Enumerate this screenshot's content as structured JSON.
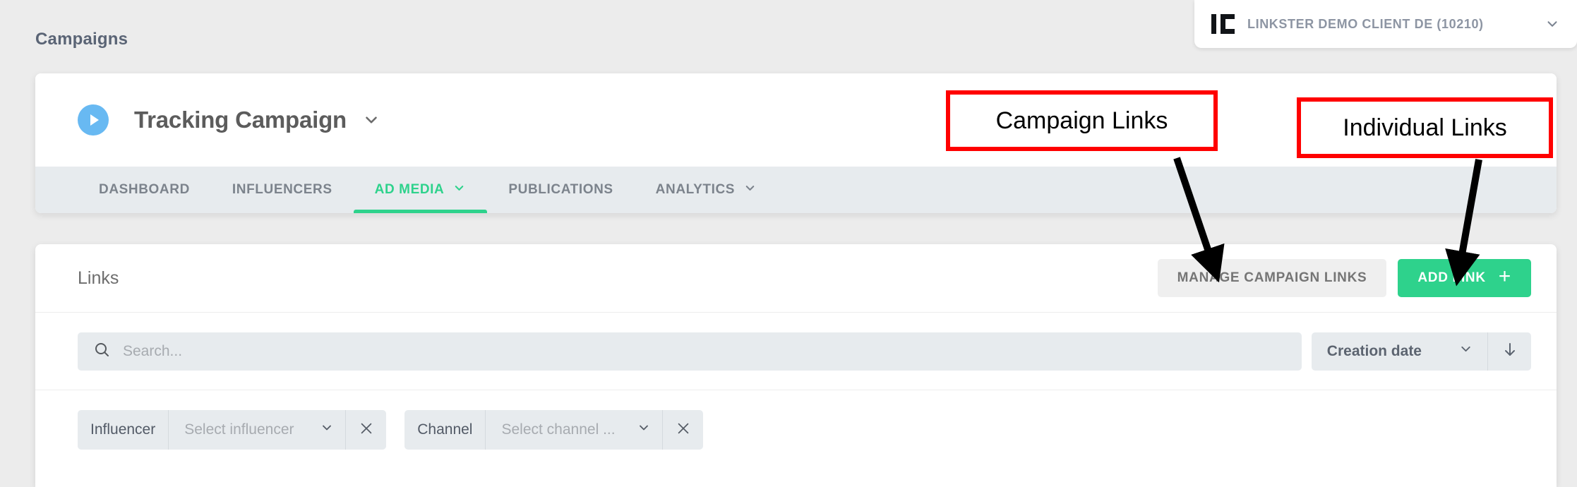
{
  "header": {
    "page_title": "Campaigns",
    "client": {
      "logo_icon": "ic-logo-icon",
      "name": "LINKSTER DEMO CLIENT DE (10210)",
      "caret_icon": "chevron-down-icon"
    }
  },
  "campaign": {
    "status_icon": "play-circle-icon",
    "title": "Tracking Campaign",
    "caret_icon": "chevron-down-icon",
    "tabs": [
      {
        "label": "DASHBOARD",
        "active": false,
        "has_caret": false
      },
      {
        "label": "INFLUENCERS",
        "active": false,
        "has_caret": false
      },
      {
        "label": "AD MEDIA",
        "active": true,
        "has_caret": true
      },
      {
        "label": "PUBLICATIONS",
        "active": false,
        "has_caret": false
      },
      {
        "label": "ANALYTICS",
        "active": false,
        "has_caret": true
      }
    ]
  },
  "links_panel": {
    "title": "Links",
    "manage_button": "MANAGE CAMPAIGN LINKS",
    "add_button": "ADD LINK",
    "add_button_icon": "plus-icon",
    "search": {
      "icon": "search-icon",
      "value": "",
      "placeholder": "Search..."
    },
    "sort": {
      "value": "Creation date",
      "caret_icon": "chevron-down-icon",
      "direction_icon": "arrow-down-icon"
    },
    "filters": [
      {
        "label": "Influencer",
        "placeholder": "Select influencer",
        "caret_icon": "chevron-down-icon",
        "clear_icon": "close-icon"
      },
      {
        "label": "Channel",
        "placeholder": "Select channel ...",
        "caret_icon": "chevron-down-icon",
        "clear_icon": "close-icon"
      }
    ]
  },
  "annotations": [
    {
      "id": "campaign-links",
      "text": "Campaign Links"
    },
    {
      "id": "individual-links",
      "text": "Individual Links"
    }
  ],
  "colors": {
    "accent_green": "#2ed28c",
    "annotation_red": "#ff0000",
    "status_blue": "#68b9f2",
    "page_bg": "#ececec",
    "tabbar_bg": "#e7ebee"
  }
}
